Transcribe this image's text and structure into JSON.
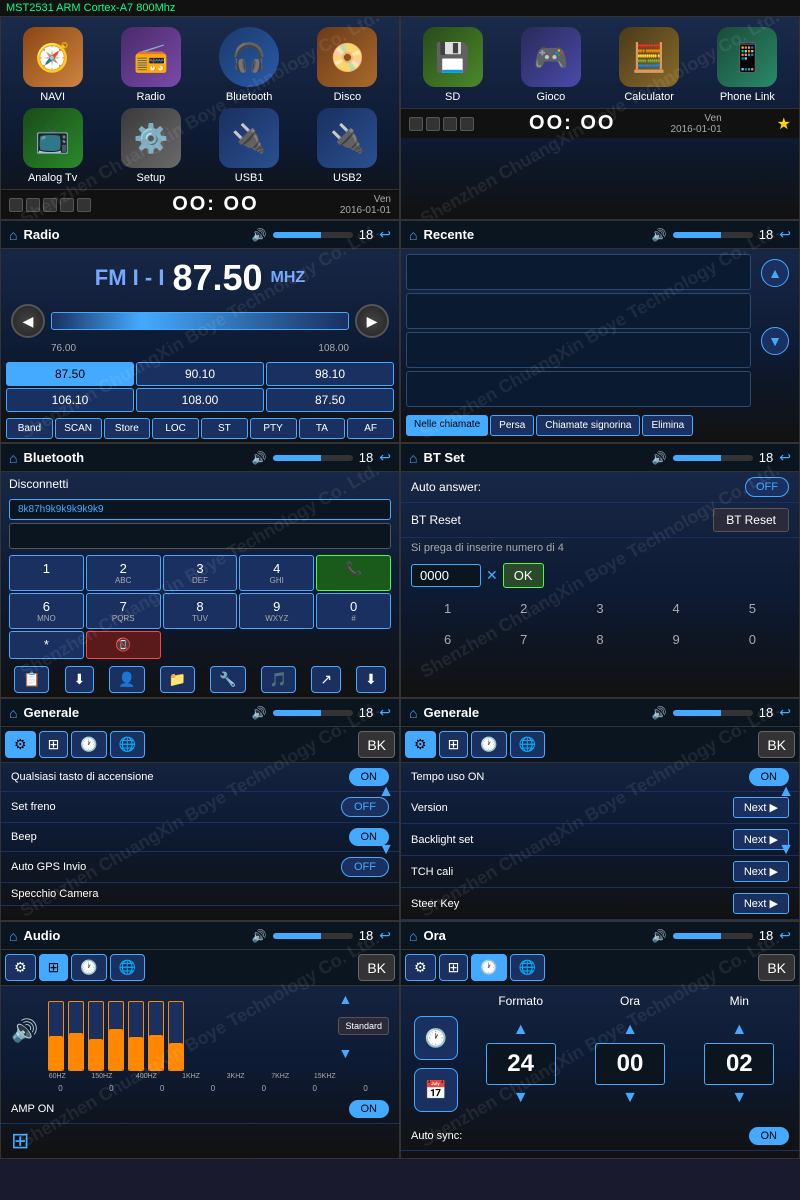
{
  "header": {
    "title": "MST2531 ARM Cortex-A7 800Mhz"
  },
  "row1": {
    "left": {
      "apps": [
        {
          "label": "NAVI",
          "icon": "🧭",
          "bg": "#3a2a1a"
        },
        {
          "label": "Radio",
          "icon": "📻",
          "bg": "#2a1a3a"
        },
        {
          "label": "Bluetooth",
          "icon": "🎧",
          "bg": "#1a2a4a"
        },
        {
          "label": "Disco",
          "icon": "📀",
          "bg": "#3a1a1a"
        },
        {
          "label": "Analog Tv",
          "icon": "📺",
          "bg": "#1a3a1a"
        },
        {
          "label": "Setup",
          "icon": "⚙️",
          "bg": "#2a2a2a"
        },
        {
          "label": "USB1",
          "icon": "🔌",
          "bg": "#1a3060"
        },
        {
          "label": "USB2",
          "icon": "🔌",
          "bg": "#1a3060"
        }
      ],
      "status": {
        "time": "OO: OO",
        "date": "Ven\n2016-01-01"
      }
    },
    "right": {
      "apps": [
        {
          "label": "SD",
          "icon": "💾",
          "bg": "#2a3a1a"
        },
        {
          "label": "Gioco",
          "icon": "🎮",
          "bg": "#1a2a4a"
        },
        {
          "label": "Calculator",
          "icon": "🧮",
          "bg": "#3a2a1a"
        },
        {
          "label": "Phone Link",
          "icon": "📱",
          "bg": "#1a3a2a"
        }
      ],
      "status": {
        "time": "OO: OO",
        "date": "Ven\n2016-01-01"
      }
    }
  },
  "row2": {
    "radio": {
      "title": "Radio",
      "volume": 18,
      "band": "FM I - I",
      "frequency": "87.50",
      "unit": "MHZ",
      "min_freq": "76.00",
      "max_freq": "108.00",
      "presets": [
        "87.50",
        "90.10",
        "98.10",
        "106.10",
        "108.00",
        "87.50"
      ],
      "controls": [
        "Band",
        "SCAN",
        "Store",
        "LOC",
        "ST",
        "PTY",
        "TA",
        "AF"
      ]
    },
    "recente": {
      "title": "Recente",
      "volume": 18,
      "tabs": [
        "Nelle chiamate",
        "Persa",
        "Chiamate signorina",
        "Elimina"
      ]
    }
  },
  "row3": {
    "bluetooth": {
      "title": "Bluetooth",
      "volume": 18,
      "disconnect_label": "Disconnetti",
      "device_id": "8k87h9k9k9k9k9k9",
      "numpad": [
        {
          "key": "1",
          "sub": ""
        },
        {
          "key": "2",
          "sub": "ABC"
        },
        {
          "key": "3",
          "sub": "DEF"
        },
        {
          "key": "4",
          "sub": "GHI"
        },
        {
          "key": "📞",
          "sub": "",
          "type": "green"
        },
        {
          "key": "6",
          "sub": "MNO"
        },
        {
          "key": "7",
          "sub": "PQRS"
        },
        {
          "key": "8",
          "sub": "TUV"
        },
        {
          "key": "9",
          "sub": "WXYZ"
        },
        {
          "key": "0",
          "sub": "#"
        },
        {
          "key": "*",
          "sub": ""
        },
        {
          "key": "📵",
          "sub": "",
          "type": "red"
        }
      ]
    },
    "btset": {
      "title": "BT Set",
      "volume": 18,
      "auto_answer_label": "Auto answer:",
      "auto_answer_value": "OFF",
      "bt_reset_label": "BT Reset",
      "bt_reset_btn": "BT Reset",
      "pin_hint": "Si prega di inserire numero di 4",
      "pin_value": "0000",
      "ok_label": "OK",
      "numkeys": [
        "1",
        "2",
        "3",
        "4",
        "5",
        "6",
        "7",
        "8",
        "9",
        "0"
      ]
    }
  },
  "row4": {
    "generale_left": {
      "title": "Generale",
      "volume": 18,
      "settings": [
        {
          "label": "Qualsiasi tasto di accensione",
          "value": "ON",
          "type": "toggle_on"
        },
        {
          "label": "Set freno",
          "value": "OFF",
          "type": "toggle_off"
        },
        {
          "label": "Beep",
          "value": "ON",
          "type": "toggle_on"
        },
        {
          "label": "Auto GPS Invio",
          "value": "OFF",
          "type": "toggle_off"
        },
        {
          "label": "Specchio Camera",
          "value": "",
          "type": "empty"
        }
      ]
    },
    "generale_right": {
      "title": "Generale",
      "volume": 18,
      "settings": [
        {
          "label": "Tempo uso ON",
          "value": "ON",
          "type": "toggle_on"
        },
        {
          "label": "Version",
          "value": "Next",
          "type": "next"
        },
        {
          "label": "Backlight set",
          "value": "Next",
          "type": "next"
        },
        {
          "label": "TCH cali",
          "value": "Next",
          "type": "next"
        },
        {
          "label": "Steer Key",
          "value": "Next",
          "type": "next"
        }
      ]
    }
  },
  "row5": {
    "audio": {
      "title": "Audio",
      "volume": 18,
      "eq_bands": [
        {
          "freq": "60HZ",
          "level": 50
        },
        {
          "freq": "150HZ",
          "level": 55
        },
        {
          "freq": "400HZ",
          "level": 45
        },
        {
          "freq": "1KHZ",
          "level": 60
        },
        {
          "freq": "3KHZ",
          "level": 48
        },
        {
          "freq": "7KHZ",
          "level": 52
        },
        {
          "freq": "15KHZ",
          "level": 40
        }
      ],
      "amp_label": "AMP ON",
      "amp_value": "ON",
      "preset_label": "Standard"
    },
    "ora": {
      "title": "Ora",
      "volume": 18,
      "formato_label": "Formato",
      "ora_label": "Ora",
      "min_label": "Min",
      "formato_value": "24",
      "ora_value": "00",
      "min_value": "02",
      "auto_sync_label": "Auto sync:",
      "auto_sync_value": "ON"
    }
  },
  "watermark": "Shenzhen ChuangXin Boye Technology Co. Ltd."
}
